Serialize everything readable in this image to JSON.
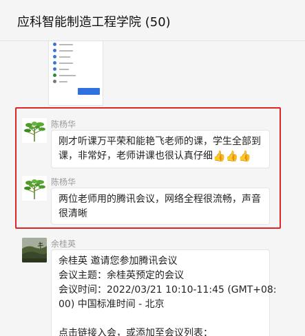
{
  "header": {
    "title": "应科智能制造工程学院 (50)"
  },
  "messages": [
    {
      "sender": "陈杨华",
      "avatar": "bamboo-plant",
      "lines": [
        "刚才听课万平荣和能艳飞老师的课，学生全部到",
        "课，非常好，老师讲课也很认真仔细"
      ],
      "emoji": [
        "thumbs-up",
        "thumbs-up",
        "thumbs-up"
      ]
    },
    {
      "sender": "陈杨华",
      "avatar": "bamboo-plant",
      "lines": [
        "两位老师用的腾讯会议，网络全程很流畅，声音",
        "很清晰"
      ]
    },
    {
      "sender": "余桂英",
      "avatar": "landscape",
      "lines": [
        "余桂英 邀请您参加腾讯会议",
        "会议主题：余桂英预定的会议",
        "会议时间：2022/03/21 10:10-11:45 (GMT+08:",
        "00) 中国标准时间 - 北京",
        "",
        "点击链接入会，或添加至会议列表："
      ]
    }
  ],
  "colors": {
    "highlight_border": "#e02424",
    "background": "#f5f5f5",
    "bubble": "#ffffff",
    "sender_name": "#9a9a9a",
    "emoji": "#f0b429"
  }
}
